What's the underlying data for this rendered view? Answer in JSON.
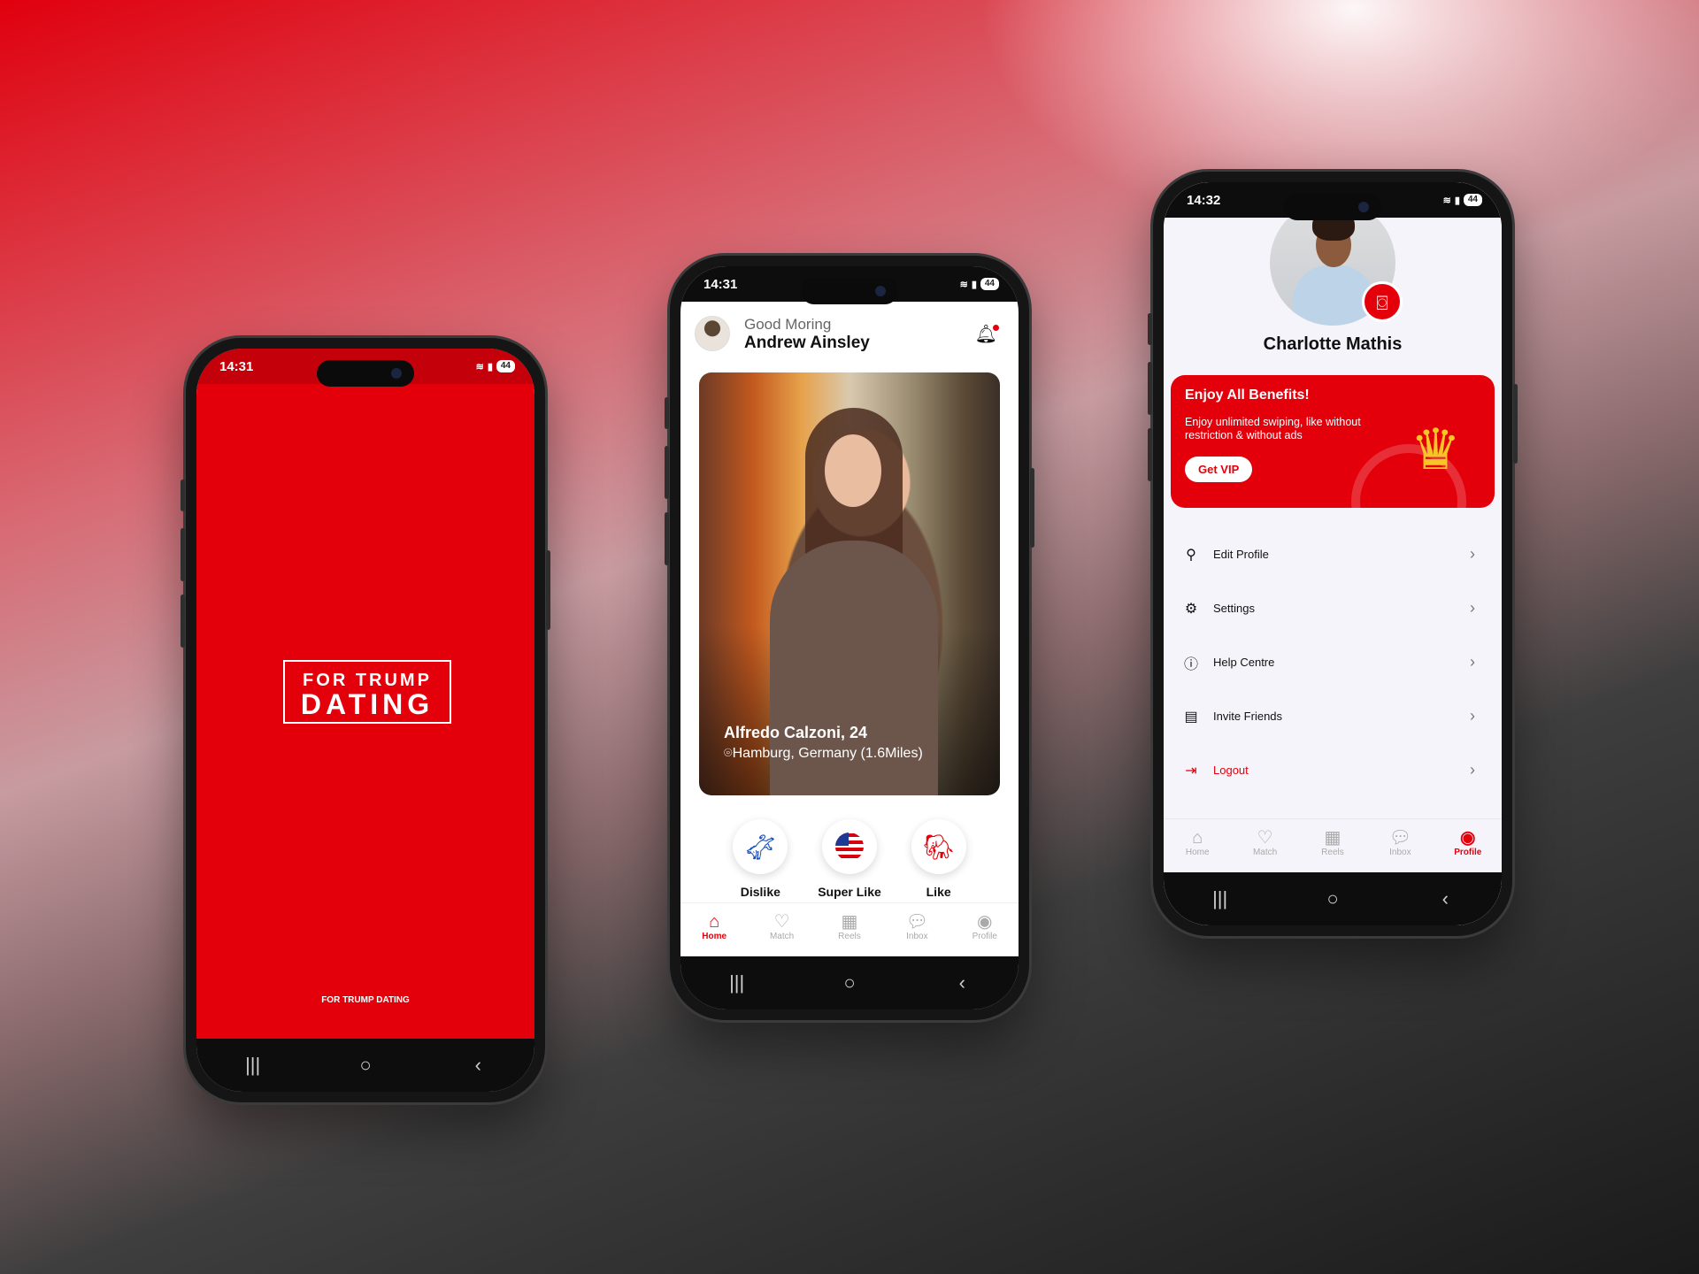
{
  "phone1": {
    "status_time": "14:31",
    "battery": "44",
    "logo_line1": "FOR TRUMP",
    "logo_line2": "DATING",
    "footer_text": "FOR TRUMP DATING",
    "brand_color": "#e3000b"
  },
  "phone2": {
    "status_time": "14:31",
    "battery": "44",
    "greeting": "Good Moring",
    "user_name": "Andrew Ainsley",
    "card": {
      "name_age": "Alfredo Calzoni, 24",
      "location": "Hamburg, Germany (1.6Miles)"
    },
    "actions": [
      {
        "label": "Dislike",
        "icon": "donkey-icon"
      },
      {
        "label": "Super Like",
        "icon": "us-flag-icon"
      },
      {
        "label": "Like",
        "icon": "elephant-icon"
      }
    ],
    "tabs": [
      {
        "label": "Home",
        "icon": "home-icon",
        "active": true
      },
      {
        "label": "Match",
        "icon": "heart-icon"
      },
      {
        "label": "Reels",
        "icon": "film-icon"
      },
      {
        "label": "Inbox",
        "icon": "chat-icon"
      },
      {
        "label": "Profile",
        "icon": "user-circle-icon"
      }
    ]
  },
  "phone3": {
    "status_time": "14:32",
    "battery": "44",
    "profile_name": "Charlotte Mathis",
    "vip": {
      "title": "Enjoy All Benefits!",
      "description": "Enjoy unlimited swiping, like without restriction & without ads",
      "button": "Get VIP"
    },
    "menu": [
      {
        "label": "Edit Profile",
        "icon": "person-icon"
      },
      {
        "label": "Settings",
        "icon": "gear-icon"
      },
      {
        "label": "Help Centre",
        "icon": "help-icon"
      },
      {
        "label": "Invite Friends",
        "icon": "gift-icon"
      },
      {
        "label": "Logout",
        "icon": "logout-icon"
      }
    ],
    "tabs": [
      {
        "label": "Home",
        "icon": "home-icon"
      },
      {
        "label": "Match",
        "icon": "heart-icon"
      },
      {
        "label": "Reels",
        "icon": "film-icon"
      },
      {
        "label": "Inbox",
        "icon": "chat-icon"
      },
      {
        "label": "Profile",
        "icon": "user-circle-icon",
        "active": true
      }
    ]
  }
}
